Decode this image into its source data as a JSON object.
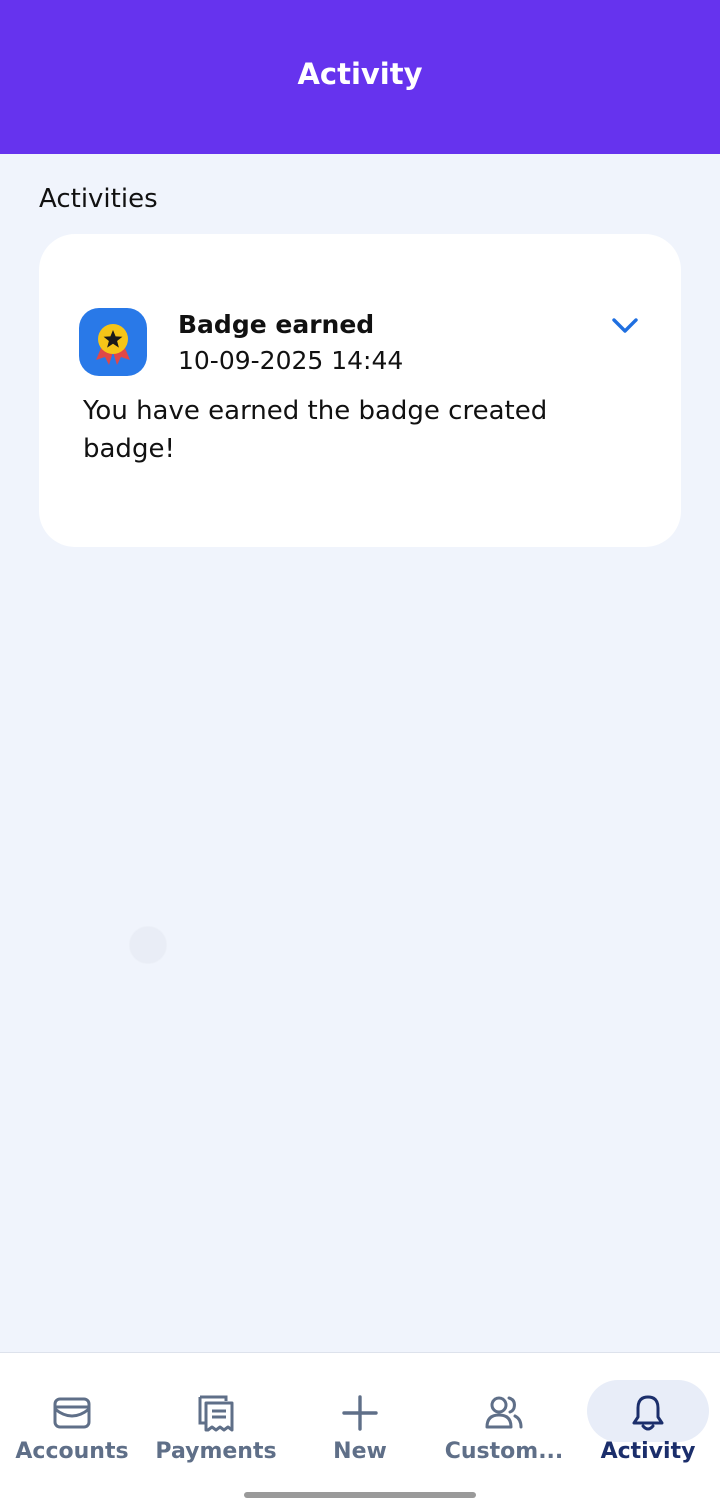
{
  "header": {
    "title": "Activity"
  },
  "section": {
    "label": "Activities"
  },
  "activity": {
    "icon": "badge-ribbon-star-icon",
    "title": "Badge earned",
    "timestamp": "10-09-2025 14:44",
    "message": "You have earned the badge created badge!",
    "expand_icon": "chevron-down-icon"
  },
  "nav": {
    "items": [
      {
        "label": "Accounts",
        "icon": "wallet-icon",
        "active": false
      },
      {
        "label": "Payments",
        "icon": "receipt-icon",
        "active": false
      },
      {
        "label": "New",
        "icon": "plus-icon",
        "active": false
      },
      {
        "label": "Custom...",
        "icon": "people-icon",
        "active": false
      },
      {
        "label": "Activity",
        "icon": "bell-icon",
        "active": true
      }
    ]
  },
  "colors": {
    "header": "#6633ee",
    "background": "#f0f4fc",
    "accent": "#2979e8",
    "nav_active": "#1b2e6b",
    "nav_inactive": "#5f6f88"
  }
}
